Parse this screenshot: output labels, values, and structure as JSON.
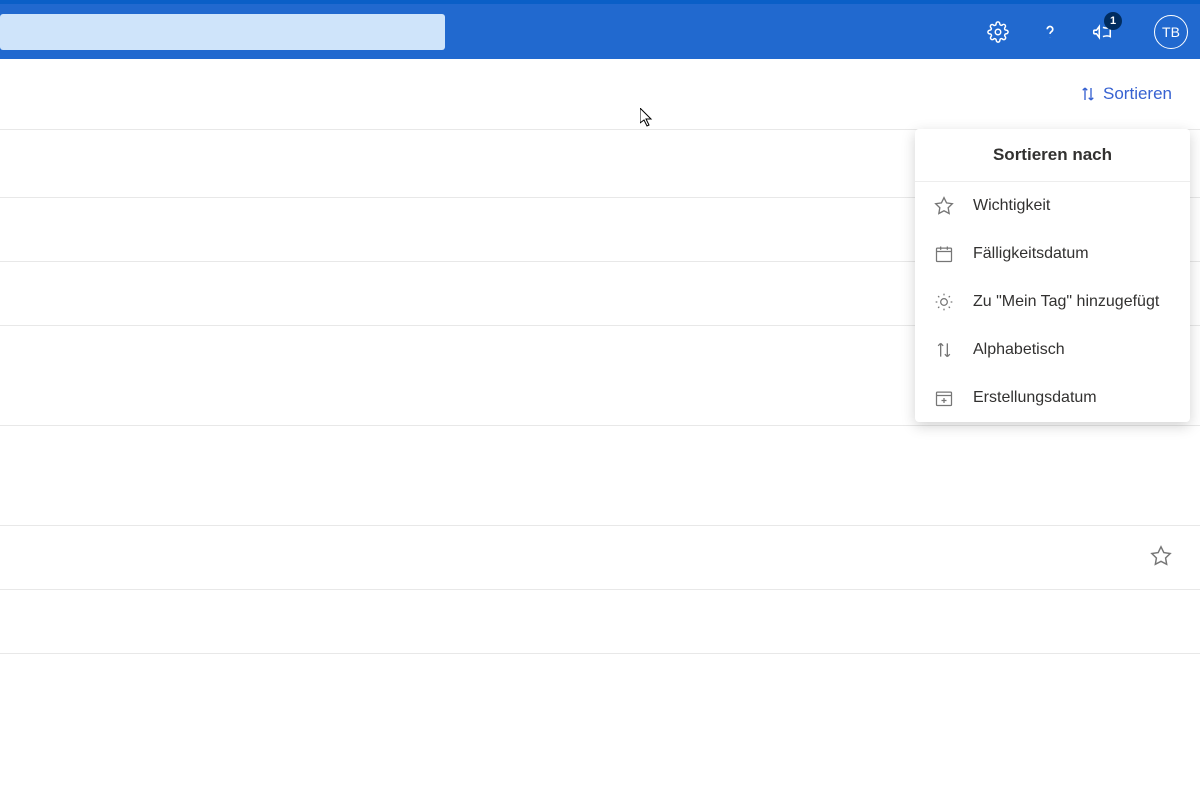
{
  "header": {
    "badge_count": "1",
    "avatar_initials": "TB"
  },
  "toolbar": {
    "sort_label": "Sortieren"
  },
  "dropdown": {
    "title": "Sortieren nach",
    "items": [
      {
        "label": "Wichtigkeit"
      },
      {
        "label": "Fälligkeitsdatum"
      },
      {
        "label": "Zu \"Mein Tag\" hinzugefügt"
      },
      {
        "label": "Alphabetisch"
      },
      {
        "label": "Erstellungsdatum"
      }
    ]
  }
}
